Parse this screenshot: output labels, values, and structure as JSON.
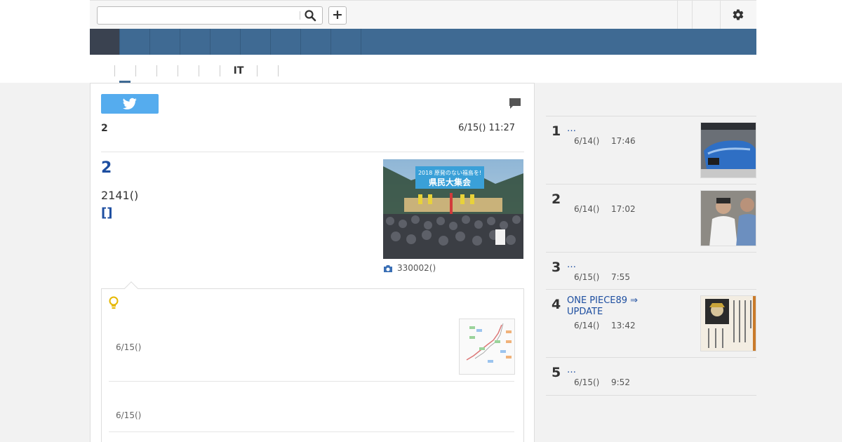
{
  "header": {
    "search_placeholder": "",
    "search_icon": "search-icon",
    "add_label": "+",
    "settings_icon": "gear-icon"
  },
  "category_tabs": [
    "",
    "",
    "",
    "",
    "",
    "IT",
    "",
    ""
  ],
  "article": {
    "pager": "2",
    "datetime": "6/15() 11:27",
    "title": "2",
    "text": "2141()",
    "link": "[]",
    "photo_caption": "330002()",
    "photo_banner_line1": "2018 原発のない福島を!",
    "photo_banner_line2": "県民大集会"
  },
  "related": {
    "items": [
      {
        "date": "6/15()"
      },
      {
        "date": "6/15()"
      }
    ]
  },
  "ranking": {
    "items": [
      {
        "rank": "1",
        "title": "…",
        "date": "6/14()",
        "time": "17:46"
      },
      {
        "rank": "2",
        "title": "",
        "date": "6/14()",
        "time": "17:02"
      },
      {
        "rank": "3",
        "title": "…",
        "date": "6/15()",
        "time": "7:55"
      },
      {
        "rank": "4",
        "title": "ONE PIECE89 ⇒ UPDATE",
        "date": "6/14()",
        "time": "13:42"
      },
      {
        "rank": "5",
        "title": "…",
        "date": "6/15()",
        "time": "9:52"
      }
    ]
  },
  "colors": {
    "nav": "#3f6a93",
    "nav_active": "#3a4250",
    "link": "#1d4ea0",
    "tweet": "#55acee",
    "bulb": "#e6b800"
  }
}
